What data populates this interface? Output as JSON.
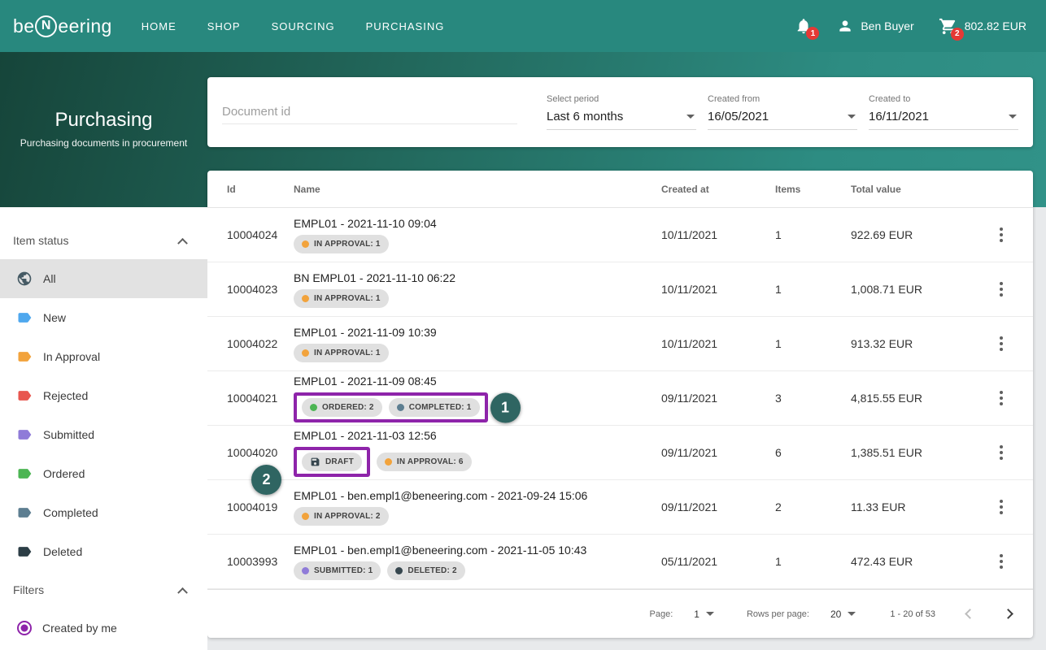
{
  "topbar": {
    "logo": {
      "prefix": "be",
      "n": "N",
      "suffix": "eering"
    },
    "nav": [
      "HOME",
      "SHOP",
      "SOURCING",
      "PURCHASING"
    ],
    "notification_count": "1",
    "user_name": "Ben Buyer",
    "cart_count": "2",
    "cart_total": "802.82 EUR"
  },
  "hero": {
    "title": "Purchasing",
    "subtitle": "Purchasing documents in procurement"
  },
  "filterbar": {
    "document_id_placeholder": "Document id",
    "period_label": "Select period",
    "period_value": "Last 6 months",
    "created_from_label": "Created from",
    "created_from_value": "16/05/2021",
    "created_to_label": "Created to",
    "created_to_value": "16/11/2021"
  },
  "sidebar": {
    "item_status_header": "Item status",
    "statuses": [
      {
        "label": "All",
        "icon": "globe",
        "selected": true
      },
      {
        "label": "New",
        "color": "#4fa8ee"
      },
      {
        "label": "In Approval",
        "color": "#f2a33c"
      },
      {
        "label": "Rejected",
        "color": "#e8564f"
      },
      {
        "label": "Submitted",
        "color": "#8f7bd8"
      },
      {
        "label": "Ordered",
        "color": "#4cb553"
      },
      {
        "label": "Completed",
        "color": "#5d7e91"
      },
      {
        "label": "Deleted",
        "color": "#2c3e46"
      }
    ],
    "filters_header": "Filters",
    "created_by_me_label": "Created by me",
    "radio_color": "#8e24aa"
  },
  "table": {
    "columns": [
      "Id",
      "Name",
      "Created at",
      "Items",
      "Total value"
    ],
    "rows": [
      {
        "id": "10004024",
        "name": "EMPL01 - 2021-11-10 09:04",
        "badges": [
          {
            "label": "IN APPROVAL: 1",
            "dot": "#f2a33c"
          }
        ],
        "created_at": "10/11/2021",
        "items": "1",
        "total": "922.69 EUR"
      },
      {
        "id": "10004023",
        "name": "BN EMPL01 - 2021-11-10 06:22",
        "badges": [
          {
            "label": "IN APPROVAL: 1",
            "dot": "#f2a33c"
          }
        ],
        "created_at": "10/11/2021",
        "items": "1",
        "total": "1,008.71 EUR"
      },
      {
        "id": "10004022",
        "name": "EMPL01 - 2021-11-09 10:39",
        "badges": [
          {
            "label": "IN APPROVAL: 1",
            "dot": "#f2a33c"
          }
        ],
        "created_at": "10/11/2021",
        "items": "1",
        "total": "913.32 EUR"
      },
      {
        "id": "10004021",
        "name": "EMPL01 - 2021-11-09 08:45",
        "badges": [
          {
            "label": "ORDERED: 2",
            "dot": "#4cb553"
          },
          {
            "label": "COMPLETED: 1",
            "dot": "#5d7e91"
          }
        ],
        "created_at": "09/11/2021",
        "items": "3",
        "total": "4,815.55 EUR",
        "annotation": {
          "number": "1",
          "scope": "all",
          "side": "right"
        }
      },
      {
        "id": "10004020",
        "name": "EMPL01 - 2021-11-03 12:56",
        "badges": [
          {
            "label": "DRAFT",
            "icon": "save"
          },
          {
            "label": "IN APPROVAL: 6",
            "dot": "#f2a33c"
          }
        ],
        "created_at": "09/11/2021",
        "items": "6",
        "total": "1,385.51 EUR",
        "annotation": {
          "number": "2",
          "scope": "first",
          "side": "left"
        }
      },
      {
        "id": "10004019",
        "name": "EMPL01 - ben.empl1@beneering.com - 2021-09-24 15:06",
        "badges": [
          {
            "label": "IN APPROVAL: 2",
            "dot": "#f2a33c"
          }
        ],
        "created_at": "09/11/2021",
        "items": "2",
        "total": "11.33 EUR"
      },
      {
        "id": "10003993",
        "name": "EMPL01 - ben.empl1@beneering.com - 2021-11-05 10:43",
        "badges": [
          {
            "label": "SUBMITTED: 1",
            "dot": "#8f7bd8"
          },
          {
            "label": "DELETED: 2",
            "dot": "#37474f"
          }
        ],
        "created_at": "05/11/2021",
        "items": "1",
        "total": "472.43 EUR"
      }
    ]
  },
  "pagination": {
    "page_label": "Page:",
    "page_value": "1",
    "rows_label": "Rows per page:",
    "rows_value": "20",
    "range": "1 - 20 of 53"
  },
  "annotations": {
    "box_color": "#8e24aa",
    "circle_color": "#2f6562"
  },
  "colors": {
    "topbar": "#28887e",
    "badge_bg": "#e0e0e0",
    "notification_badge": "#e53935"
  }
}
